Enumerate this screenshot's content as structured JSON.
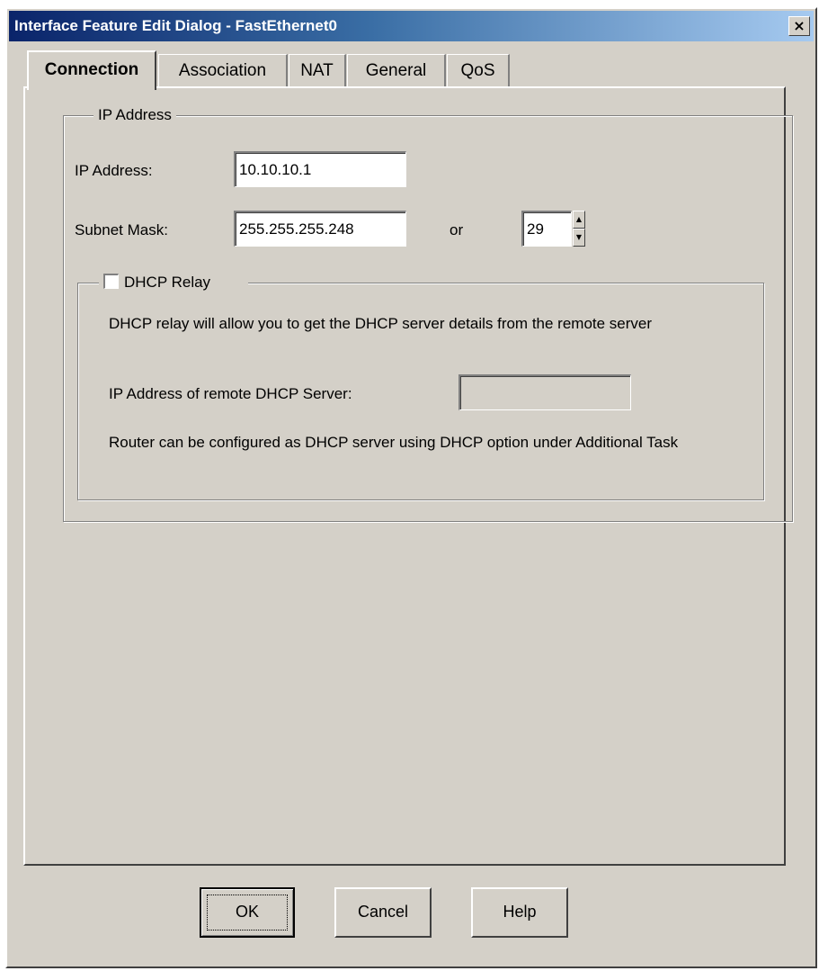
{
  "window": {
    "title": "Interface Feature Edit Dialog - FastEthernet0",
    "close_glyph": "×"
  },
  "tabs": [
    {
      "label": "Connection",
      "active": true
    },
    {
      "label": "Association",
      "active": false
    },
    {
      "label": "NAT",
      "active": false
    },
    {
      "label": "General",
      "active": false
    },
    {
      "label": "QoS",
      "active": false
    }
  ],
  "ip_group": {
    "legend": "IP Address",
    "ip_label": "IP Address:",
    "ip_value": "10.10.10.1",
    "mask_label": "Subnet Mask:",
    "mask_value": "255.255.255.248",
    "or_label": "or",
    "prefix_value": "29"
  },
  "dhcp": {
    "checkbox_label": "DHCP Relay",
    "checked": false,
    "description": "DHCP relay will allow you to get the DHCP server details from the remote server",
    "remote_label": "IP Address of remote DHCP Server:",
    "remote_value": "",
    "note": "Router can be configured as DHCP server using DHCP option under Additional Task"
  },
  "buttons": {
    "ok": "OK",
    "cancel": "Cancel",
    "help": "Help"
  },
  "icons": {
    "close": "close-icon",
    "spin_up": "spin-up-icon",
    "spin_down": "spin-down-icon"
  }
}
